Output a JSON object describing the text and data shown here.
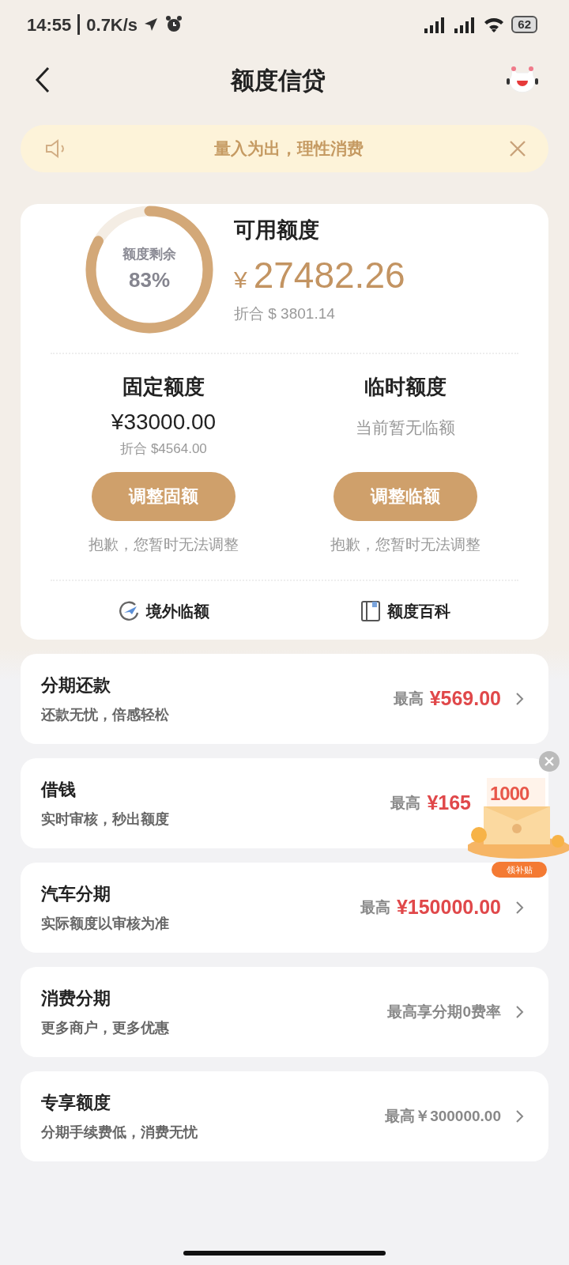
{
  "status_bar": {
    "time": "14:55",
    "speed": "0.7K/s",
    "battery": "62"
  },
  "header": {
    "title": "额度信贷"
  },
  "notice": {
    "text": "量入为出，理性消费"
  },
  "credit": {
    "ring_label": "额度剩余",
    "ring_percent": "83%",
    "level": 0.83,
    "available_label": "可用额度",
    "currency": "¥",
    "available_amount": "27482.26",
    "converted": "折合 $ 3801.14",
    "columns": [
      {
        "title": "固定额度",
        "amount": "¥33000.00",
        "converted": "折合 $4564.00",
        "button": "调整固额",
        "note": "抱歉，您暂时无法调整"
      },
      {
        "title": "临时额度",
        "empty_text": "当前暂无临额",
        "button": "调整临额",
        "note": "抱歉，您暂时无法调整"
      }
    ],
    "links": [
      {
        "label": "境外临额",
        "kind": "plane"
      },
      {
        "label": "额度百科",
        "kind": "book"
      }
    ]
  },
  "products": [
    {
      "title": "分期还款",
      "subtitle": "还款无忧，倍感轻松",
      "kind": "amount",
      "prefix": "最高",
      "value": "¥569.00",
      "chevron": true
    },
    {
      "title": "借钱",
      "subtitle": "实时审核，秒出额度",
      "kind": "amount",
      "prefix": "最高",
      "value": "¥165",
      "chevron": false
    },
    {
      "title": "汽车分期",
      "subtitle": "实际额度以审核为准",
      "kind": "amount",
      "prefix": "最高",
      "value": "¥150000.00",
      "chevron": true
    },
    {
      "title": "消费分期",
      "subtitle": "更多商户，更多优惠",
      "kind": "text",
      "value": "最高享分期0费率",
      "chevron": true
    },
    {
      "title": "专享额度",
      "subtitle": "分期手续费低，消费无忧",
      "kind": "text",
      "value": "最高￥300000.00",
      "chevron": true
    }
  ],
  "promo": {
    "amount": "1000",
    "button": "领补贴"
  }
}
